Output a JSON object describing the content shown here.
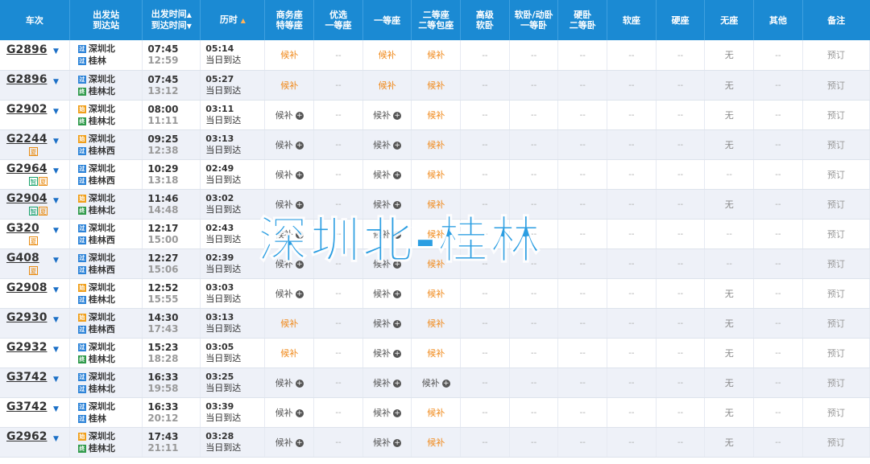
{
  "headers": {
    "train": "车次",
    "station_l1": "出发站",
    "station_l2": "到达站",
    "time_l1": "出发时间",
    "time_l2": "到达时间",
    "duration": "历时",
    "seats": [
      [
        "商务座",
        "特等座"
      ],
      [
        "优选",
        "一等座"
      ],
      [
        "一等座",
        ""
      ],
      [
        "二等座",
        "二等包座"
      ],
      [
        "高级",
        "软卧"
      ],
      [
        "软卧/动卧",
        "一等卧"
      ],
      [
        "硬卧",
        "二等卧"
      ],
      [
        "软座",
        ""
      ],
      [
        "硬座",
        ""
      ],
      [
        "无座",
        ""
      ],
      [
        "其他",
        ""
      ]
    ],
    "note": "备注"
  },
  "watermark": "深圳北-桂林",
  "icons": {
    "sort_up": "▲",
    "sort_down": "▼",
    "expand": "▼",
    "plus": "+"
  },
  "rows": [
    {
      "train": "G2896",
      "tags": [],
      "dep_icon": "过",
      "dep": "深圳北",
      "arr_icon": "过",
      "arr": "桂林",
      "dep_time": "07:45",
      "arr_time": "12:59",
      "duration": "05:14",
      "arrive_day": "当日到达",
      "seats": [
        "候补",
        "--",
        "候补",
        "候补",
        "--",
        "--",
        "--",
        "--",
        "--",
        "无",
        "--"
      ],
      "book": "预订"
    },
    {
      "train": "G2896",
      "tags": [],
      "dep_icon": "过",
      "dep": "深圳北",
      "arr_icon": "终",
      "arr": "桂林北",
      "dep_time": "07:45",
      "arr_time": "13:12",
      "duration": "05:27",
      "arrive_day": "当日到达",
      "seats": [
        "候补",
        "--",
        "候补",
        "候补",
        "--",
        "--",
        "--",
        "--",
        "--",
        "无",
        "--"
      ],
      "book": "预订"
    },
    {
      "train": "G2902",
      "tags": [],
      "dep_icon": "始",
      "dep": "深圳北",
      "arr_icon": "终",
      "arr": "桂林北",
      "dep_time": "08:00",
      "arr_time": "11:11",
      "duration": "03:11",
      "arrive_day": "当日到达",
      "seats": [
        "候补+",
        "--",
        "候补+",
        "候补",
        "--",
        "--",
        "--",
        "--",
        "--",
        "无",
        "--"
      ],
      "book": "预订"
    },
    {
      "train": "G2244",
      "tags": [
        "夏"
      ],
      "dep_icon": "始",
      "dep": "深圳北",
      "arr_icon": "过",
      "arr": "桂林西",
      "dep_time": "09:25",
      "arr_time": "12:38",
      "duration": "03:13",
      "arrive_day": "当日到达",
      "seats": [
        "候补+",
        "--",
        "候补+",
        "候补",
        "--",
        "--",
        "--",
        "--",
        "--",
        "无",
        "--"
      ],
      "book": "预订"
    },
    {
      "train": "G2964",
      "tags": [
        "智",
        "夏"
      ],
      "dep_icon": "过",
      "dep": "深圳北",
      "arr_icon": "过",
      "arr": "桂林西",
      "dep_time": "10:29",
      "arr_time": "13:18",
      "duration": "02:49",
      "arrive_day": "当日到达",
      "seats": [
        "候补+",
        "--",
        "候补+",
        "候补",
        "--",
        "--",
        "--",
        "--",
        "--",
        "--",
        "--"
      ],
      "book": "预订"
    },
    {
      "train": "G2904",
      "tags": [
        "智",
        "夏"
      ],
      "dep_icon": "始",
      "dep": "深圳北",
      "arr_icon": "终",
      "arr": "桂林北",
      "dep_time": "11:46",
      "arr_time": "14:48",
      "duration": "03:02",
      "arrive_day": "当日到达",
      "seats": [
        "候补+",
        "--",
        "候补+",
        "候补",
        "--",
        "--",
        "--",
        "--",
        "--",
        "无",
        "--"
      ],
      "book": "预订"
    },
    {
      "train": "G320",
      "tags": [
        "夏"
      ],
      "dep_icon": "过",
      "dep": "深圳北",
      "arr_icon": "过",
      "arr": "桂林西",
      "dep_time": "12:17",
      "arr_time": "15:00",
      "duration": "02:43",
      "arrive_day": "当日到达",
      "seats": [
        "候补+",
        "--",
        "候补+",
        "候补",
        "--",
        "--",
        "--",
        "--",
        "--",
        "--",
        "--"
      ],
      "book": "预订"
    },
    {
      "train": "G408",
      "tags": [
        "夏"
      ],
      "dep_icon": "过",
      "dep": "深圳北",
      "arr_icon": "过",
      "arr": "桂林西",
      "dep_time": "12:27",
      "arr_time": "15:06",
      "duration": "02:39",
      "arrive_day": "当日到达",
      "seats": [
        "候补+",
        "--",
        "候补+",
        "候补",
        "--",
        "--",
        "--",
        "--",
        "--",
        "--",
        "--"
      ],
      "book": "预订"
    },
    {
      "train": "G2908",
      "tags": [],
      "dep_icon": "始",
      "dep": "深圳北",
      "arr_icon": "过",
      "arr": "桂林北",
      "dep_time": "12:52",
      "arr_time": "15:55",
      "duration": "03:03",
      "arrive_day": "当日到达",
      "seats": [
        "候补+",
        "--",
        "候补+",
        "候补",
        "--",
        "--",
        "--",
        "--",
        "--",
        "无",
        "--"
      ],
      "book": "预订"
    },
    {
      "train": "G2930",
      "tags": [],
      "dep_icon": "始",
      "dep": "深圳北",
      "arr_icon": "过",
      "arr": "桂林西",
      "dep_time": "14:30",
      "arr_time": "17:43",
      "duration": "03:13",
      "arrive_day": "当日到达",
      "seats": [
        "候补",
        "--",
        "候补+",
        "候补",
        "--",
        "--",
        "--",
        "--",
        "--",
        "无",
        "--"
      ],
      "book": "预订"
    },
    {
      "train": "G2932",
      "tags": [],
      "dep_icon": "过",
      "dep": "深圳北",
      "arr_icon": "终",
      "arr": "桂林北",
      "dep_time": "15:23",
      "arr_time": "18:28",
      "duration": "03:05",
      "arrive_day": "当日到达",
      "seats": [
        "候补",
        "--",
        "候补+",
        "候补",
        "--",
        "--",
        "--",
        "--",
        "--",
        "无",
        "--"
      ],
      "book": "预订"
    },
    {
      "train": "G3742",
      "tags": [],
      "dep_icon": "过",
      "dep": "深圳北",
      "arr_icon": "过",
      "arr": "桂林北",
      "dep_time": "16:33",
      "arr_time": "19:58",
      "duration": "03:25",
      "arrive_day": "当日到达",
      "seats": [
        "候补+",
        "--",
        "候补+",
        "候补+",
        "--",
        "--",
        "--",
        "--",
        "--",
        "无",
        "--"
      ],
      "book": "预订"
    },
    {
      "train": "G3742",
      "tags": [],
      "dep_icon": "过",
      "dep": "深圳北",
      "arr_icon": "过",
      "arr": "桂林",
      "dep_time": "16:33",
      "arr_time": "20:12",
      "duration": "03:39",
      "arrive_day": "当日到达",
      "seats": [
        "候补+",
        "--",
        "候补+",
        "候补",
        "--",
        "--",
        "--",
        "--",
        "--",
        "无",
        "--"
      ],
      "book": "预订"
    },
    {
      "train": "G2962",
      "tags": [],
      "dep_icon": "始",
      "dep": "深圳北",
      "arr_icon": "终",
      "arr": "桂林北",
      "dep_time": "17:43",
      "arr_time": "21:11",
      "duration": "03:28",
      "arrive_day": "当日到达",
      "seats": [
        "候补+",
        "--",
        "候补+",
        "候补",
        "--",
        "--",
        "--",
        "--",
        "--",
        "无",
        "--"
      ],
      "book": "预订"
    }
  ],
  "colors": {
    "header_bg": "#1b8ad3",
    "wait": "#f08a1c",
    "row_alt": "#eef1f8",
    "watermark": "#1a96e0"
  }
}
